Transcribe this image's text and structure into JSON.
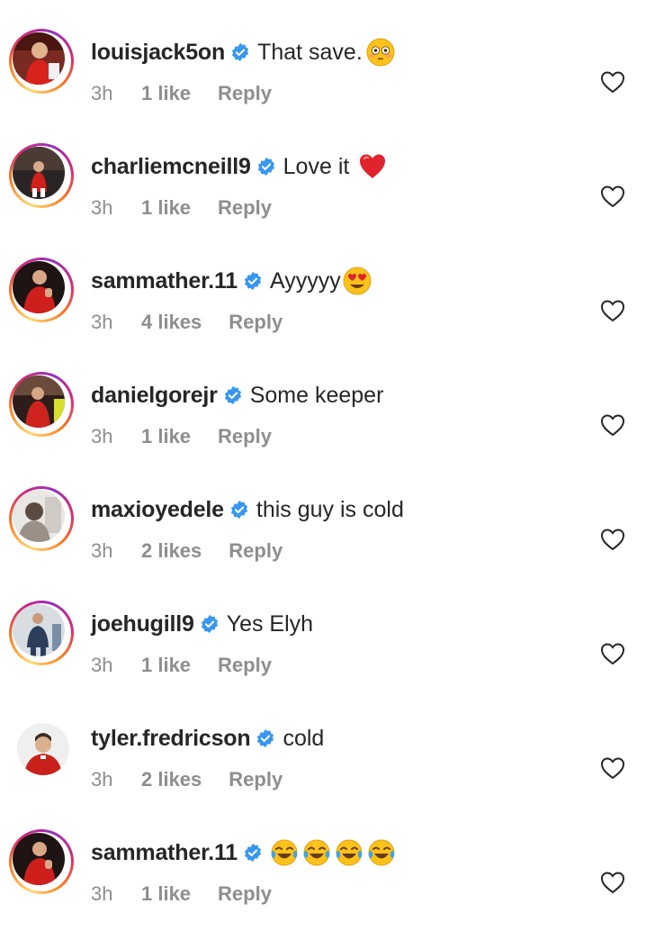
{
  "colors": {
    "text": "#262626",
    "meta": "#8e8e8e",
    "verified": "#3897f0",
    "story_ring": "instagram-gradient"
  },
  "comments": [
    {
      "username": "louisjack5on",
      "text": "That save.",
      "emoji": "flushed-face",
      "time": "3h",
      "likes": "1 like",
      "reply": "Reply",
      "ring": true
    },
    {
      "username": "charliemcneill9",
      "text": "Love it",
      "emoji": "red-heart",
      "time": "3h",
      "likes": "1 like",
      "reply": "Reply",
      "ring": true
    },
    {
      "username": "sammather.11",
      "text": "Ayyyyy",
      "emoji": "heart-eyes-face",
      "time": "3h",
      "likes": "4 likes",
      "reply": "Reply",
      "ring": true
    },
    {
      "username": "danielgorejr",
      "text": "Some keeper",
      "emoji": "",
      "time": "3h",
      "likes": "1 like",
      "reply": "Reply",
      "ring": true
    },
    {
      "username": "maxioyedele",
      "text": "this guy is cold",
      "emoji": "",
      "time": "3h",
      "likes": "2 likes",
      "reply": "Reply",
      "ring": true
    },
    {
      "username": "joehugill9",
      "text": "Yes Elyh",
      "emoji": "",
      "time": "3h",
      "likes": "1 like",
      "reply": "Reply",
      "ring": true
    },
    {
      "username": "tyler.fredricson",
      "text": "cold",
      "emoji": "",
      "time": "3h",
      "likes": "2 likes",
      "reply": "Reply",
      "ring": false
    },
    {
      "username": "sammather.11",
      "text": "",
      "emoji": "tears-of-joy-face x4",
      "time": "3h",
      "likes": "1 like",
      "reply": "Reply",
      "ring": true
    }
  ]
}
